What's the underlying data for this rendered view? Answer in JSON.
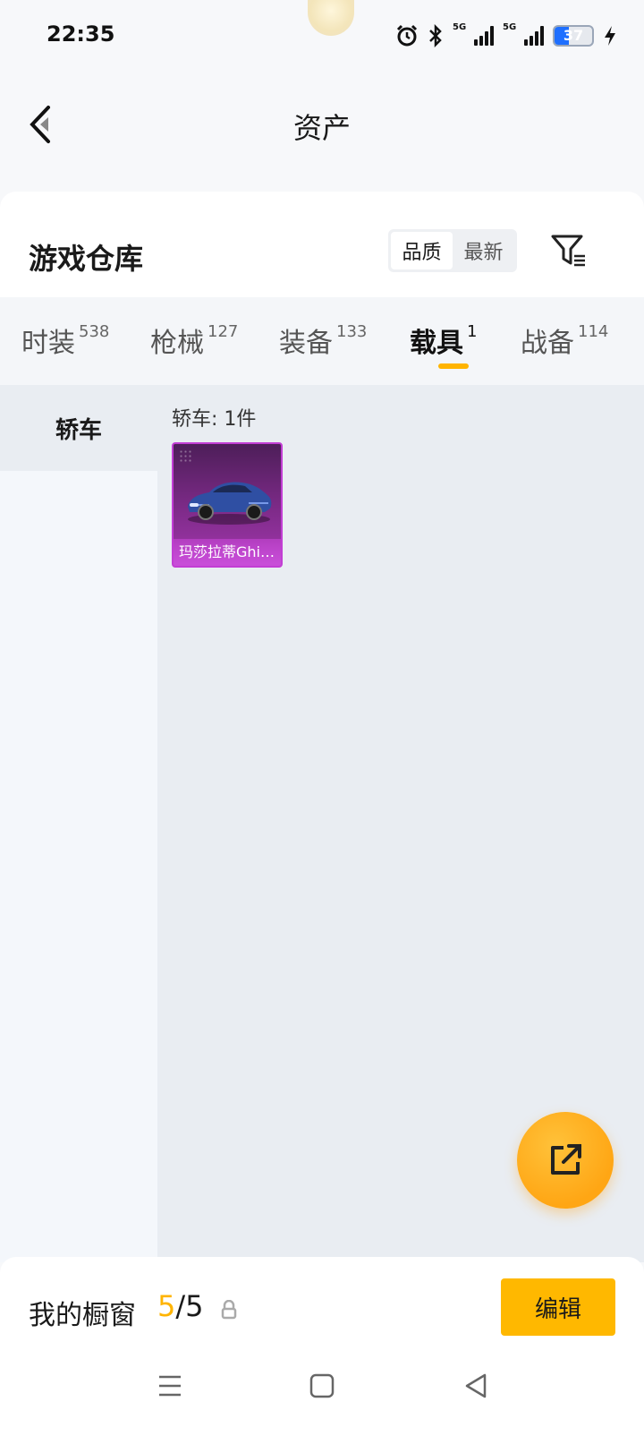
{
  "status_bar": {
    "time": "22:35",
    "battery_percent": 37,
    "network_tags": [
      "5G",
      "5G"
    ],
    "icons": [
      "alarm-icon",
      "bluetooth-icon",
      "signal-5g-icon",
      "signal-5g-icon",
      "battery-icon",
      "charging-icon"
    ]
  },
  "header": {
    "title": "资产",
    "back_icon": "chevron-left-icon"
  },
  "warehouse": {
    "title": "游戏仓库",
    "sort_options": [
      "品质",
      "最新"
    ],
    "sort_selected": "品质",
    "filter_icon": "filter-icon"
  },
  "tabs": [
    {
      "label": "时装",
      "count": "538"
    },
    {
      "label": "枪械",
      "count": "127"
    },
    {
      "label": "装备",
      "count": "133"
    },
    {
      "label": "载具",
      "count": "1",
      "active": true
    },
    {
      "label": "战备",
      "count": "114"
    }
  ],
  "sidebar": {
    "items": [
      {
        "label": "轿车",
        "active": true
      }
    ]
  },
  "content": {
    "section_count": "轿车: 1件",
    "items": [
      {
        "name": "玛莎拉蒂Ghib...",
        "rarity_color": "#c23ed4",
        "image": "car-icon"
      }
    ]
  },
  "fab": {
    "icon": "share-icon"
  },
  "showcase": {
    "label": "我的橱窗",
    "current": "5",
    "separator": "/",
    "total": "5",
    "lock_icon": "lock-icon"
  },
  "edit_button": {
    "label": "编辑"
  },
  "nav": {
    "icons": [
      "menu-icon",
      "home-icon",
      "back-icon"
    ]
  },
  "colors": {
    "accent": "#ffb400",
    "rarity_purple": "#c23ed4",
    "battery": "#1e6fff"
  }
}
